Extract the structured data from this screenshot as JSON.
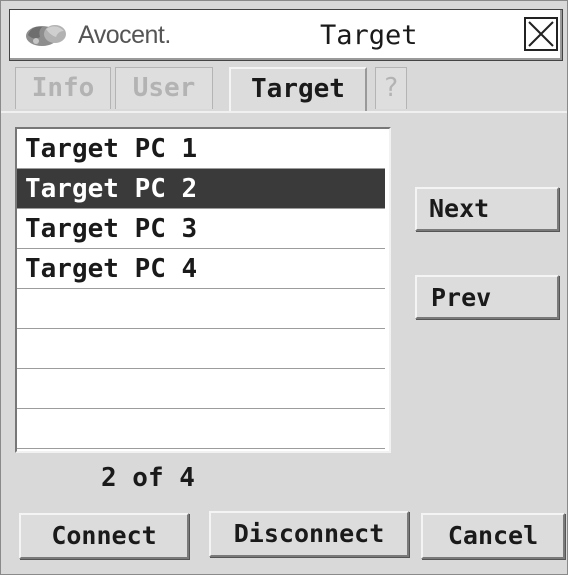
{
  "window": {
    "title": "Target",
    "brand": "Avocent."
  },
  "tabs": [
    {
      "label": "Info",
      "active": false
    },
    {
      "label": "User",
      "active": false
    },
    {
      "label": "Target",
      "active": true
    },
    {
      "label": "?",
      "active": false
    }
  ],
  "targets": {
    "items": [
      "Target PC 1",
      "Target PC 2",
      "Target PC 3",
      "Target PC 4",
      "",
      "",
      "",
      ""
    ],
    "selected_index": 1
  },
  "buttons": {
    "next": "Next",
    "prev": "Prev",
    "connect": "Connect",
    "disconnect": "Disconnect",
    "cancel": "Cancel"
  },
  "pagination": {
    "text": "2 of 4"
  },
  "colors": {
    "selection": "#3a3a3a",
    "background": "#d9d9d9"
  },
  "icons": {
    "logo": "avocent-logo-icon",
    "close": "close-icon"
  }
}
